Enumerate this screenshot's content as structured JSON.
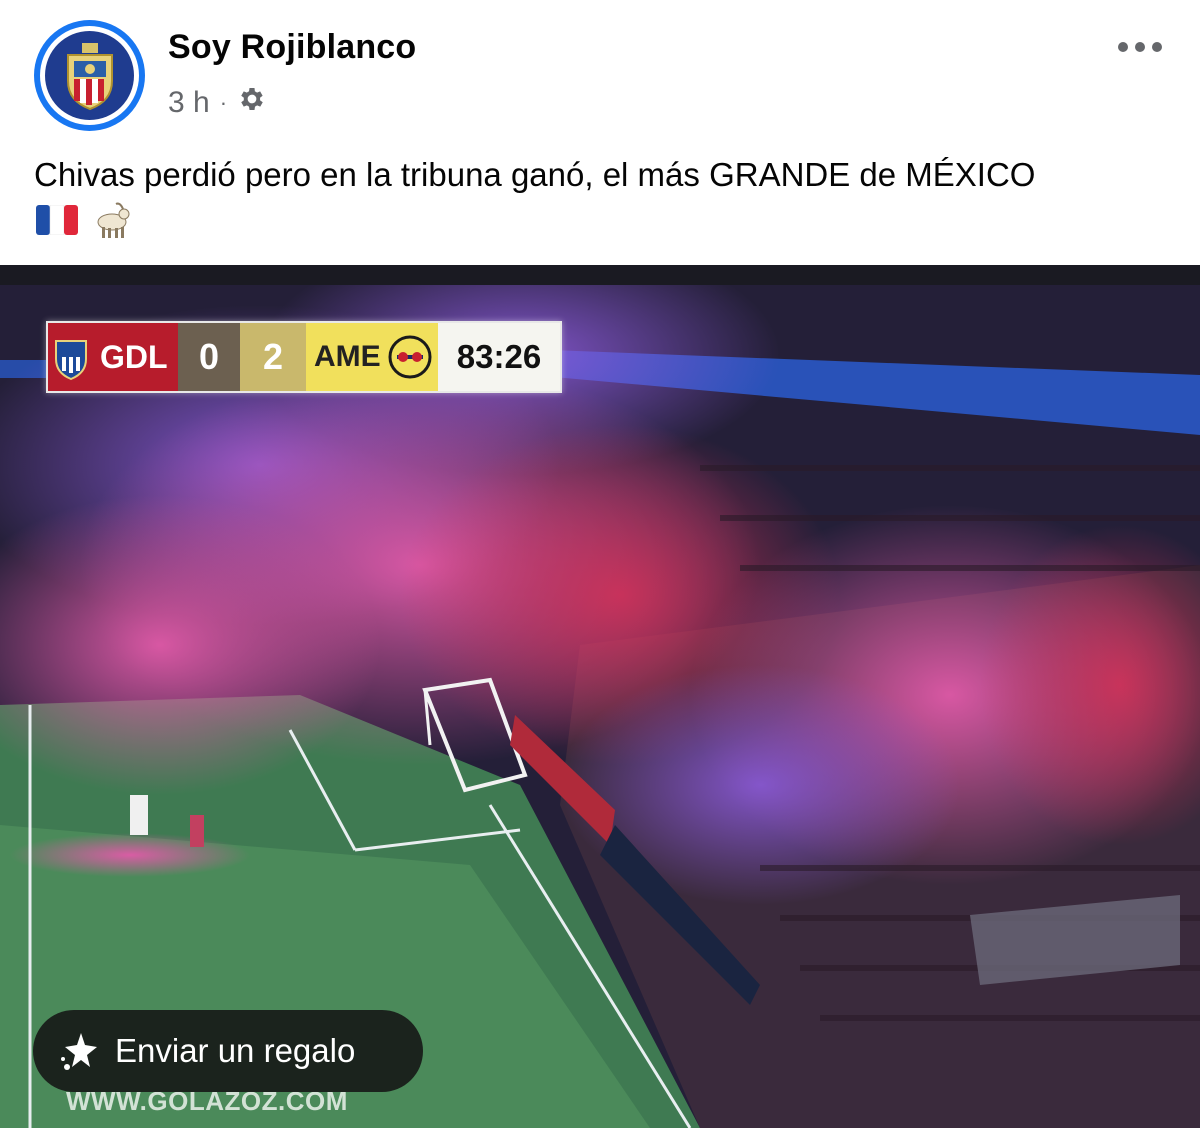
{
  "post": {
    "page_name": "Soy Rojiblanco",
    "time": "3 h",
    "separator": "·",
    "privacy_icon": "gear-icon",
    "more_icon": "more-horizontal-icon",
    "caption": "Chivas perdió pero en la tribuna ganó, el más GRANDE de MÉXICO",
    "emojis": [
      "france-flag-icon",
      "goat-icon"
    ]
  },
  "photo": {
    "scoreboard": {
      "home": "GDL",
      "home_score": "0",
      "away_score": "2",
      "away": "AME",
      "clock": "83:26"
    },
    "watermark": "WWW.GOLAZOZ.COM"
  },
  "gift_button": {
    "label": "Enviar un regalo",
    "icon": "gift-sparkle-icon"
  },
  "colors": {
    "accent": "#1877f2",
    "text_primary": "#050505",
    "text_secondary": "#65676b"
  }
}
